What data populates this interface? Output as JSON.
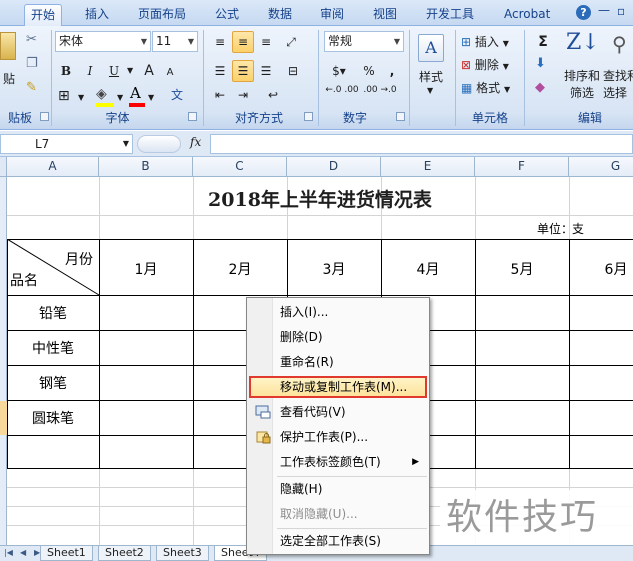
{
  "ribbon_tabs": {
    "home": "开始",
    "insert": "插入",
    "page_layout": "页面布局",
    "formulas": "公式",
    "data": "数据",
    "review": "审阅",
    "view": "视图",
    "developer": "开发工具",
    "acrobat": "Acrobat"
  },
  "ribbon": {
    "clipboard": {
      "paste_label": "贴",
      "group_label": "贴板"
    },
    "font": {
      "name": "宋体",
      "size": "11",
      "bold": "B",
      "italic": "I",
      "underline": "U",
      "grow": "A",
      "shrink": "A",
      "wen": "文",
      "yin": "变",
      "group_label": "字体"
    },
    "alignment": {
      "group_label": "对齐方式"
    },
    "number": {
      "format": "常规",
      "percent": "%",
      "comma": ",",
      "inc_decimal": "←.0 .00",
      "dec_decimal": ".00 →.0",
      "group_label": "数字"
    },
    "styles": {
      "label": "样式"
    },
    "cells": {
      "insert": "插入",
      "delete": "删除",
      "format": "格式",
      "group_label": "单元格"
    },
    "editing": {
      "sigma": "Σ",
      "sort_line1": "排序和",
      "sort_line2": "筛选",
      "find_line1": "查找和",
      "find_line2": "选择",
      "group_label": "编辑"
    }
  },
  "formula_bar": {
    "name_box": "L7",
    "fx": "fx",
    "formula": ""
  },
  "columns": [
    "A",
    "B",
    "C",
    "D",
    "E",
    "F",
    "G"
  ],
  "sheet": {
    "title": "2018年上半年进货情况表",
    "unit_label": "单位：",
    "unit_value": "支",
    "header_month": "月份",
    "header_item": "品名",
    "months": [
      "1月",
      "2月",
      "3月",
      "4月",
      "5月",
      "6月"
    ],
    "items": [
      "铅笔",
      "中性笔",
      "钢笔",
      "圆珠笔",
      ""
    ]
  },
  "sheet_tabs": [
    "Sheet1",
    "Sheet2",
    "Sheet3",
    "Sheet4"
  ],
  "context_menu": {
    "insert": "插入(I)...",
    "delete": "删除(D)",
    "rename": "重命名(R)",
    "move_copy": "移动或复制工作表(M)...",
    "view_code": "查看代码(V)",
    "protect": "保护工作表(P)...",
    "tab_color": "工作表标签颜色(T)",
    "hide": "隐藏(H)",
    "unhide": "取消隐藏(U)...",
    "select_all": "选定全部工作表(S)"
  },
  "watermark": "软件技巧",
  "colors": {
    "ribbon_text": "#15428b",
    "highlight_border": "#e03a2f",
    "highlight_fill": "#fde39c"
  }
}
